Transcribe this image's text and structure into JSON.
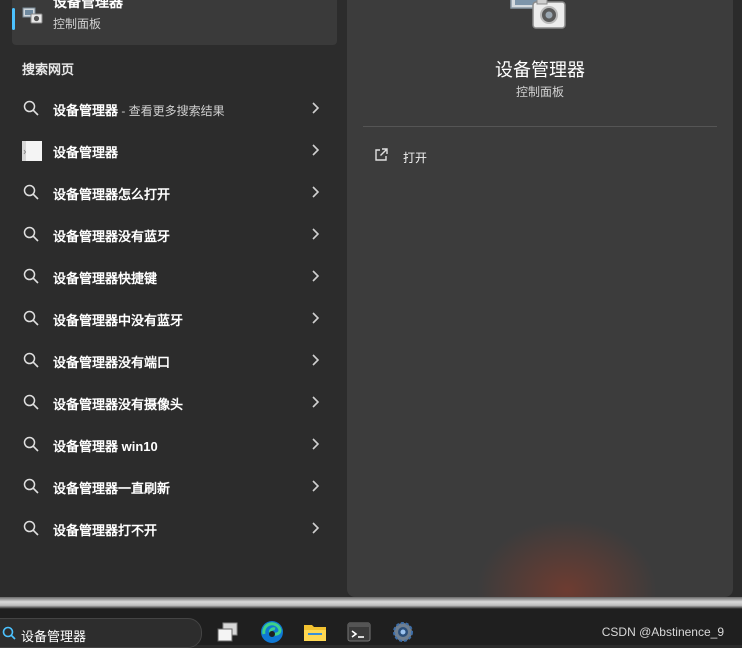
{
  "best_match": {
    "title": "设备管理器",
    "subtitle": "控制面板",
    "icon": "device-manager-icon"
  },
  "section_label": "搜索网页",
  "results": [
    {
      "label": "设备管理器",
      "suffix": " - 查看更多搜索结果",
      "icon": "search-icon"
    },
    {
      "label": "设备管理器",
      "suffix": "",
      "icon": "web-thumbnail-icon"
    },
    {
      "label": "设备管理器怎么打开",
      "suffix": "",
      "icon": "search-icon"
    },
    {
      "label": "设备管理器没有蓝牙",
      "suffix": "",
      "icon": "search-icon"
    },
    {
      "label": "设备管理器快捷键",
      "suffix": "",
      "icon": "search-icon"
    },
    {
      "label": "设备管理器中没有蓝牙",
      "suffix": "",
      "icon": "search-icon"
    },
    {
      "label": "设备管理器没有端口",
      "suffix": "",
      "icon": "search-icon"
    },
    {
      "label": "设备管理器没有摄像头",
      "suffix": "",
      "icon": "search-icon"
    },
    {
      "label": "设备管理器 win10",
      "suffix": "",
      "icon": "search-icon"
    },
    {
      "label": "设备管理器一直刷新",
      "suffix": "",
      "icon": "search-icon"
    },
    {
      "label": "设备管理器打不开",
      "suffix": "",
      "icon": "search-icon"
    }
  ],
  "detail": {
    "title": "设备管理器",
    "subtitle": "控制面板",
    "actions": [
      {
        "label": "打开",
        "icon": "open-external-icon"
      }
    ]
  },
  "taskbar": {
    "search_value": "设备管理器",
    "apps": [
      "task-view-icon",
      "edge-icon",
      "file-explorer-icon",
      "terminal-icon",
      "settings-icon"
    ]
  },
  "watermark": "CSDN @Abstinence_9",
  "colors": {
    "accent": "#4cc2ff",
    "pane_left": "#2c2c2c",
    "pane_right": "#3c3c3c",
    "taskbar": "#1f1f1f"
  }
}
